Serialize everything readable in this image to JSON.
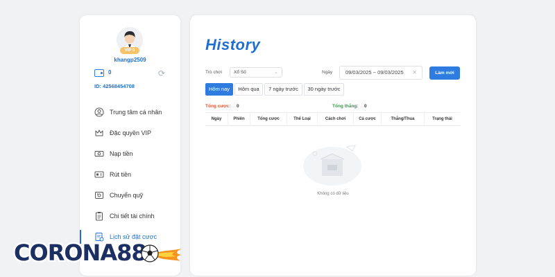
{
  "sidebar": {
    "avatar_badge": "VIP 0",
    "username": "khangp2509",
    "balance": "0",
    "user_id": "ID: 42568454708",
    "menu": [
      {
        "label": "Trung tâm cá nhân",
        "icon": "user-circle-icon"
      },
      {
        "label": "Đặc quyền VIP",
        "icon": "crown-icon"
      },
      {
        "label": "Nạp tiền",
        "icon": "cash-icon"
      },
      {
        "label": "Rút tiền",
        "icon": "card-icon"
      },
      {
        "label": "Chuyển quỹ",
        "icon": "transfer-icon"
      },
      {
        "label": "Chi tiết tài chính",
        "icon": "clipboard-icon"
      },
      {
        "label": "Lịch sử đặt cược",
        "icon": "history-doc-icon",
        "active": true
      }
    ]
  },
  "brand": {
    "logo_text": "CORONA88"
  },
  "main": {
    "title": "History",
    "filters": {
      "game_label": "Trò chơi",
      "game_value": "Xổ Số",
      "date_label": "Ngày",
      "date_range": "09/03/2025 ~ 09/03/2025",
      "refresh_label": "Làm mới"
    },
    "quick_ranges": [
      "Hôm nay",
      "Hôm qua",
      "7 ngày trước",
      "30 ngày trước"
    ],
    "summary": {
      "bet_label": "Tổng cược:",
      "bet_value": "0",
      "win_label": "Tổng thắng:",
      "win_value": "0"
    },
    "columns": [
      "Ngày",
      "Phiên",
      "Tổng cược",
      "Thể Loại",
      "Cách chơi",
      "Cá cược",
      "Thắng/Thua",
      "Trạng thái"
    ],
    "empty_text": "Không có dữ liệu"
  },
  "colors": {
    "accent": "#2f7ce0",
    "bet": "#e0502a",
    "win": "#2e9a45"
  }
}
